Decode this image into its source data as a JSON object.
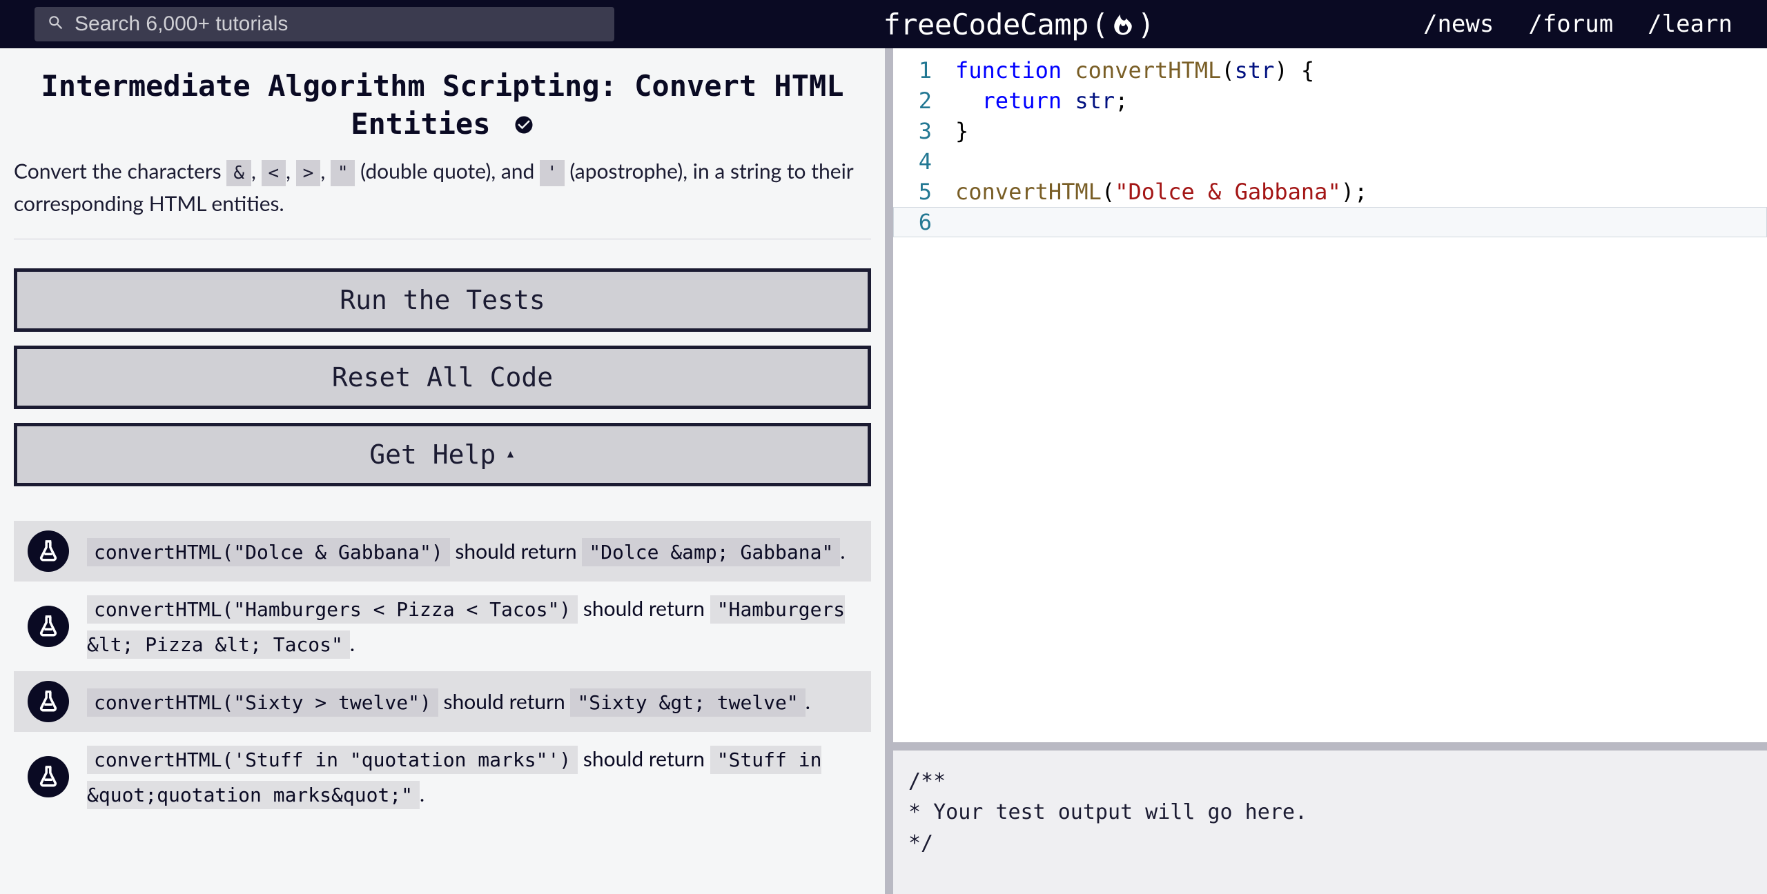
{
  "header": {
    "search_placeholder": "Search 6,000+ tutorials",
    "brand": "freeCodeCamp",
    "nav": {
      "news": "/news",
      "forum": "/forum",
      "learn": "/learn"
    }
  },
  "challenge": {
    "title": "Intermediate Algorithm Scripting: Convert HTML Entities",
    "desc_prefix": "Convert the characters ",
    "chars": [
      "&",
      "<",
      ">",
      "\""
    ],
    "desc_mid1": " (double quote), and ",
    "char_apos": "'",
    "desc_mid2": " (apostrophe), in a string to their corresponding HTML entities."
  },
  "buttons": {
    "run": "Run the Tests",
    "reset": "Reset All Code",
    "help": "Get Help"
  },
  "tests": [
    {
      "call": "convertHTML(\"Dolce & Gabbana\")",
      "mid": " should return ",
      "ret": "\"Dolce &amp; Gabbana\"",
      "tail": "."
    },
    {
      "call": "convertHTML(\"Hamburgers < Pizza < Tacos\")",
      "mid": " should return ",
      "ret": "\"Hamburgers &lt; Pizza &lt; Tacos\"",
      "tail": "."
    },
    {
      "call": "convertHTML(\"Sixty > twelve\")",
      "mid": " should return ",
      "ret": "\"Sixty &gt; twelve\"",
      "tail": "."
    },
    {
      "call": "convertHTML('Stuff in \"quotation marks\"')",
      "mid": " should return ",
      "ret": "\"Stuff in &quot;quotation marks&quot;\"",
      "tail": "."
    }
  ],
  "editor": {
    "lines": [
      [
        {
          "t": "function ",
          "c": "tk-keyword"
        },
        {
          "t": "convertHTML",
          "c": "tk-func"
        },
        {
          "t": "(",
          "c": "tk-punct"
        },
        {
          "t": "str",
          "c": "tk-ident"
        },
        {
          "t": ") {",
          "c": "tk-punct"
        }
      ],
      [
        {
          "t": "  ",
          "c": ""
        },
        {
          "t": "return ",
          "c": "tk-keyword"
        },
        {
          "t": "str",
          "c": "tk-ident"
        },
        {
          "t": ";",
          "c": "tk-punct"
        }
      ],
      [
        {
          "t": "}",
          "c": "tk-punct"
        }
      ],
      [],
      [
        {
          "t": "convertHTML",
          "c": "tk-func"
        },
        {
          "t": "(",
          "c": "tk-punct"
        },
        {
          "t": "\"Dolce & Gabbana\"",
          "c": "tk-string"
        },
        {
          "t": ");",
          "c": "tk-punct"
        }
      ],
      []
    ],
    "active_line_index": 5
  },
  "output": "/**\n* Your test output will go here.\n*/"
}
